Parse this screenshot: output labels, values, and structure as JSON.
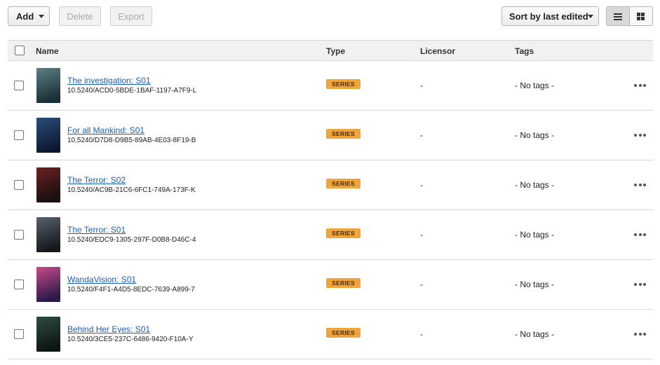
{
  "toolbar": {
    "add_label": "Add",
    "delete_label": "Delete",
    "export_label": "Export",
    "sort_label": "Sort by last edited"
  },
  "table": {
    "columns": {
      "name": "Name",
      "type": "Type",
      "licensor": "Licensor",
      "tags": "Tags"
    },
    "rows": [
      {
        "title": "The investigation: S01",
        "doi": "10.5240/ACD0-5BDE-1BAF-1197-A7F9-L",
        "type": "SERIES",
        "licensor": "-",
        "tags": "- No tags -",
        "thumb_colors": [
          "#5d7f86",
          "#1b2f36"
        ]
      },
      {
        "title": "For all Mankind: S01",
        "doi": "10.5240/D7D8-D9B5-89AB-4E03-8F19-B",
        "type": "SERIES",
        "licensor": "-",
        "tags": "- No tags -",
        "thumb_colors": [
          "#2c4c7c",
          "#0d1830"
        ]
      },
      {
        "title": "The Terror: S02",
        "doi": "10.5240/AC9B-21C6-6FC1-749A-173F-K",
        "type": "SERIES",
        "licensor": "-",
        "tags": "- No tags -",
        "thumb_colors": [
          "#6b2020",
          "#1a1010"
        ]
      },
      {
        "title": "The Terror: S01",
        "doi": "10.5240/EDC9-1305-297F-D0B8-D46C-4",
        "type": "SERIES",
        "licensor": "-",
        "tags": "- No tags -",
        "thumb_colors": [
          "#58616b",
          "#15191e"
        ]
      },
      {
        "title": "WandaVision: S01",
        "doi": "10.5240/F4F1-A4D5-8EDC-7639-A899-7",
        "type": "SERIES",
        "licensor": "-",
        "tags": "- No tags -",
        "thumb_colors": [
          "#c94a8a",
          "#2a1a4a"
        ]
      },
      {
        "title": "Behind Her Eyes: S01",
        "doi": "10.5240/3CE5-237C-6486-9420-F10A-Y",
        "type": "SERIES",
        "licensor": "-",
        "tags": "- No tags -",
        "thumb_colors": [
          "#2f4a45",
          "#0e1614"
        ]
      }
    ]
  },
  "colors": {
    "badge": "#f0a53a",
    "link": "#1a5fb4",
    "header_bg": "#f1f1f1"
  }
}
